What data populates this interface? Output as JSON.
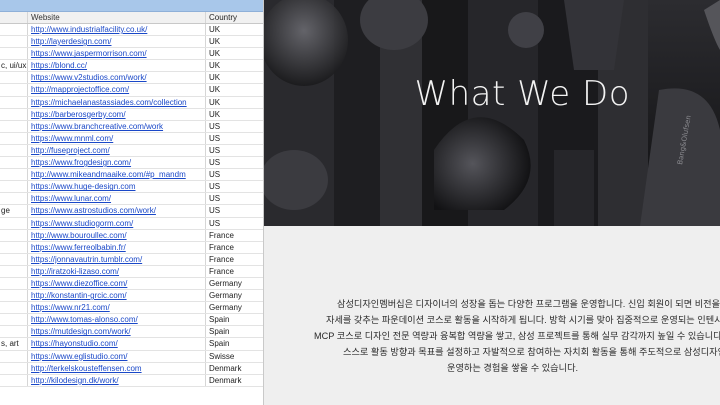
{
  "sheet": {
    "headers": [
      "",
      "Website",
      "Country"
    ],
    "rows": [
      {
        "a": "",
        "url": "http://www.industrialfacility.co.uk/",
        "country": "UK"
      },
      {
        "a": "",
        "url": "http://layerdesign.com/",
        "country": "UK"
      },
      {
        "a": "",
        "url": "https://www.jaspermorrison.com/",
        "country": "UK"
      },
      {
        "a": "c, ui/ux",
        "url": "https://blond.cc/",
        "country": "UK"
      },
      {
        "a": "",
        "url": "https://www.v2studios.com/work/",
        "country": "UK"
      },
      {
        "a": "",
        "url": "http://mapprojectoffice.com/",
        "country": "UK"
      },
      {
        "a": "",
        "url": "https://michaelanastassiades.com/collection",
        "country": "UK"
      },
      {
        "a": "",
        "url": "https://barberosgerby.com/",
        "country": "UK"
      },
      {
        "a": "",
        "url": "https://www.branchcreative.com/work",
        "country": "US"
      },
      {
        "a": "",
        "url": "https://www.mnml.com/",
        "country": "US"
      },
      {
        "a": "",
        "url": "http://fuseproject.com/",
        "country": "US"
      },
      {
        "a": "",
        "url": "https://www.frogdesign.com/",
        "country": "US"
      },
      {
        "a": "",
        "url": "http://www.mikeandmaaike.com/#p_mandm",
        "country": "US"
      },
      {
        "a": "",
        "url": "https://www.huge-design.com",
        "country": "US"
      },
      {
        "a": "",
        "url": "https://www.lunar.com/",
        "country": "US"
      },
      {
        "a": "ge",
        "url": "https://www.astrostudios.com/work/",
        "country": "US"
      },
      {
        "a": "",
        "url": "https://www.studiogorm.com/",
        "country": "US"
      },
      {
        "a": "",
        "url": "http://www.bouroullec.com/",
        "country": "France"
      },
      {
        "a": "",
        "url": "https://www.ferreolbabin.fr/",
        "country": "France"
      },
      {
        "a": "",
        "url": "https://jonnavautrin.tumblr.com/",
        "country": "France"
      },
      {
        "a": "",
        "url": "http://iratzoki-lizaso.com/",
        "country": "France"
      },
      {
        "a": "",
        "url": "https://www.diezoffice.com/",
        "country": "Germany"
      },
      {
        "a": "",
        "url": "http://konstantin-grcic.com/",
        "country": "Germany"
      },
      {
        "a": "",
        "url": "https://www.nr21.com/",
        "country": "Germany"
      },
      {
        "a": "",
        "url": "http://www.tomas-alonso.com/",
        "country": "Spain"
      },
      {
        "a": "",
        "url": "https://mutdesign.com/work/",
        "country": "Spain"
      },
      {
        "a": "s, art",
        "url": "https://hayonstudio.com/",
        "country": "Spain"
      },
      {
        "a": "",
        "url": "https://www.eglistudio.com/",
        "country": "Swisse"
      },
      {
        "a": "",
        "url": "http://terkelskousteffensen.com",
        "country": "Denmark"
      },
      {
        "a": "",
        "url": "http://kilodesign.dk/work/",
        "country": "Denmark"
      }
    ]
  },
  "hero": {
    "title": "What We Do",
    "product_text": "Bang&Olufsen"
  },
  "about": {
    "lines": [
      "삼성디자인멤버십은 디자이너의 성장을 돕는 다양한 프로그램을 운영합니다. 신입 회원이 되면 비전을 공유하고 기",
      "자세를 갖추는 파운데이션 코스로 활동을 시작하게 됩니다. 방학 시기를 맞아 집중적으로 운영되는 인텐시브 코스",
      "MCP 코스로 디자인 전문 역량과 융복합 역량을 쌓고, 삼성 프로젝트를 통해 실무 감각까지 높일 수 있습니다. 또한",
      "스스로 활동 방향과 목표를 설정하고 자발적으로 참여하는 자치회 활동을 통해 주도적으로 삼성디자인멤버십을",
      "운영하는 경험을 쌓을 수 있습니다."
    ]
  },
  "colors": {
    "link": "#1a48c8",
    "hero_bg": "#1c1c1f",
    "about_bg": "#efefef",
    "sheet_topbar": "#a8c7ea"
  }
}
